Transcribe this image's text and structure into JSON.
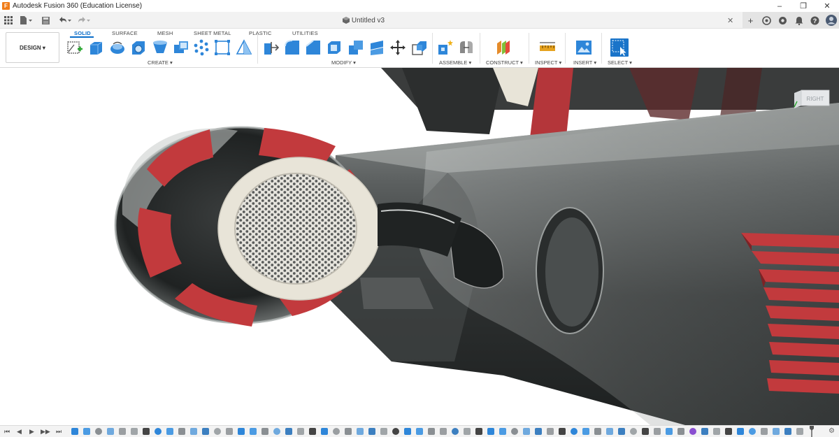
{
  "window": {
    "title": "Autodesk Fusion 360 (Education License)",
    "logo_letter": "F",
    "controls": [
      "–",
      "❐",
      "✕"
    ]
  },
  "document": {
    "tab_title": "Untitled v3",
    "close": "✕"
  },
  "qat": {
    "grid_icon": "grid-icon",
    "file_icon": "file-icon",
    "save_icon": "save-icon",
    "undo_icon": "undo-icon",
    "redo_icon": "redo-icon"
  },
  "tab_strip_right": {
    "add": "+",
    "online_icon": "online-status-icon",
    "jobs_icon": "job-status-icon",
    "notifications_icon": "bell-icon",
    "help": "?",
    "profile_icon": "user-avatar-icon"
  },
  "ribbon": {
    "workspace": "DESIGN ▾",
    "tabs": [
      "SOLID",
      "SURFACE",
      "MESH",
      "SHEET METAL",
      "PLASTIC",
      "UTILITIES"
    ],
    "active_tab": "SOLID",
    "groups": {
      "create": "CREATE ▾",
      "modify": "MODIFY ▾",
      "assemble": "ASSEMBLE ▾",
      "construct": "CONSTRUCT ▾",
      "inspect": "INSPECT ▾",
      "insert": "INSERT ▾",
      "select": "SELECT ▾"
    }
  },
  "viewcube": {
    "face_label": "RIGHT"
  },
  "colors": {
    "accent": "#0a6dc9",
    "model_red": "#c23a3d",
    "model_dark": "#2a2c2c",
    "model_glass": "#6f7373",
    "nozzle_ring": "#e8e4d8"
  },
  "timeline": {
    "controls": [
      "⏮",
      "◀",
      "▶",
      "▶▶",
      "⏭"
    ]
  }
}
